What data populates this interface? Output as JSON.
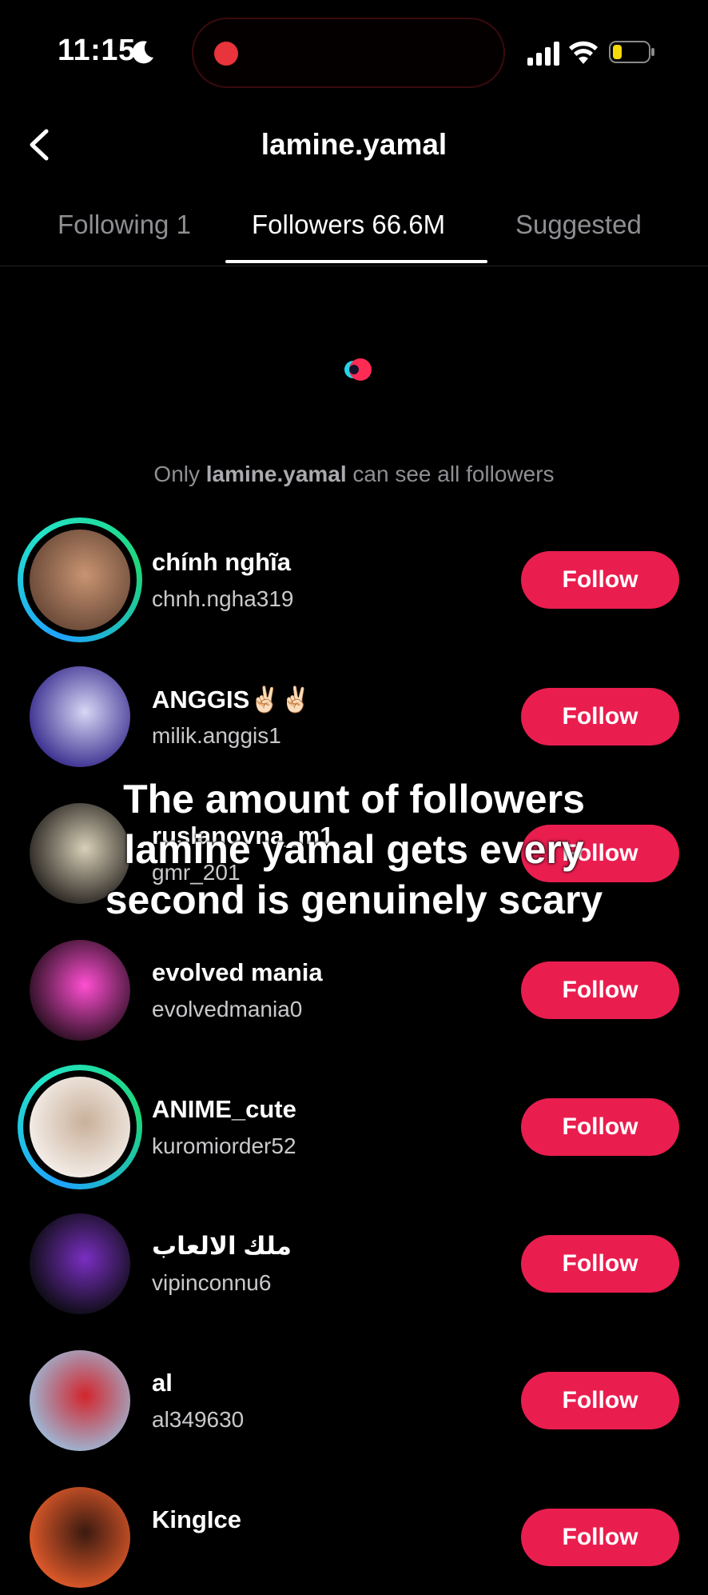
{
  "status": {
    "time": "11:15"
  },
  "header": {
    "title": "lamine.yamal"
  },
  "tabs": [
    {
      "label": "Following 1",
      "active": false
    },
    {
      "label": "Followers 66.6M",
      "active": true
    },
    {
      "label": "Suggested",
      "active": false
    }
  ],
  "notice": {
    "prefix": "Only ",
    "username": "lamine.yamal",
    "suffix": " can see all followers"
  },
  "followers": [
    {
      "name": "chính nghĩa",
      "handle": "chnh.ngha319",
      "button": "Follow",
      "story_ring": true,
      "avatar_colors": [
        "#6a4a38",
        "#c99472"
      ]
    },
    {
      "name": "ANGGIS✌🏻✌🏻",
      "handle": "milik.anggis1",
      "button": "Follow",
      "story_ring": false,
      "avatar_colors": [
        "#3a2f8f",
        "#d8d6f5"
      ]
    },
    {
      "name": "ruslanovna_m1",
      "handle": "gmr_201",
      "button": "Follow",
      "story_ring": false,
      "avatar_colors": [
        "#2a2622",
        "#d9d0b8"
      ]
    },
    {
      "name": "evolved mania",
      "handle": "evolvedmania0",
      "button": "Follow",
      "story_ring": false,
      "avatar_colors": [
        "#2b0f22",
        "#ff4fd2"
      ]
    },
    {
      "name": "ANIME_cute",
      "handle": "kuromiorder52",
      "button": "Follow",
      "story_ring": true,
      "avatar_colors": [
        "#f4eee9",
        "#c9b09a"
      ]
    },
    {
      "name": "ملك الالعاب",
      "handle": "vipinconnu6",
      "button": "Follow",
      "story_ring": false,
      "avatar_colors": [
        "#0c0c12",
        "#7a2fc2"
      ]
    },
    {
      "name": "al",
      "handle": "al349630",
      "button": "Follow",
      "story_ring": false,
      "avatar_colors": [
        "#9db8d6",
        "#d2252c"
      ]
    },
    {
      "name": "KingIce",
      "handle": "",
      "button": "Follow",
      "story_ring": false,
      "avatar_colors": [
        "#e05a2a",
        "#3a1a10"
      ]
    }
  ],
  "overlay_caption": {
    "line1": "The amount of followers",
    "line2": "lamine yamal gets every",
    "line3": "second is genuinely scary"
  },
  "colors": {
    "accent": "#ea1d4f",
    "background": "#000000"
  }
}
